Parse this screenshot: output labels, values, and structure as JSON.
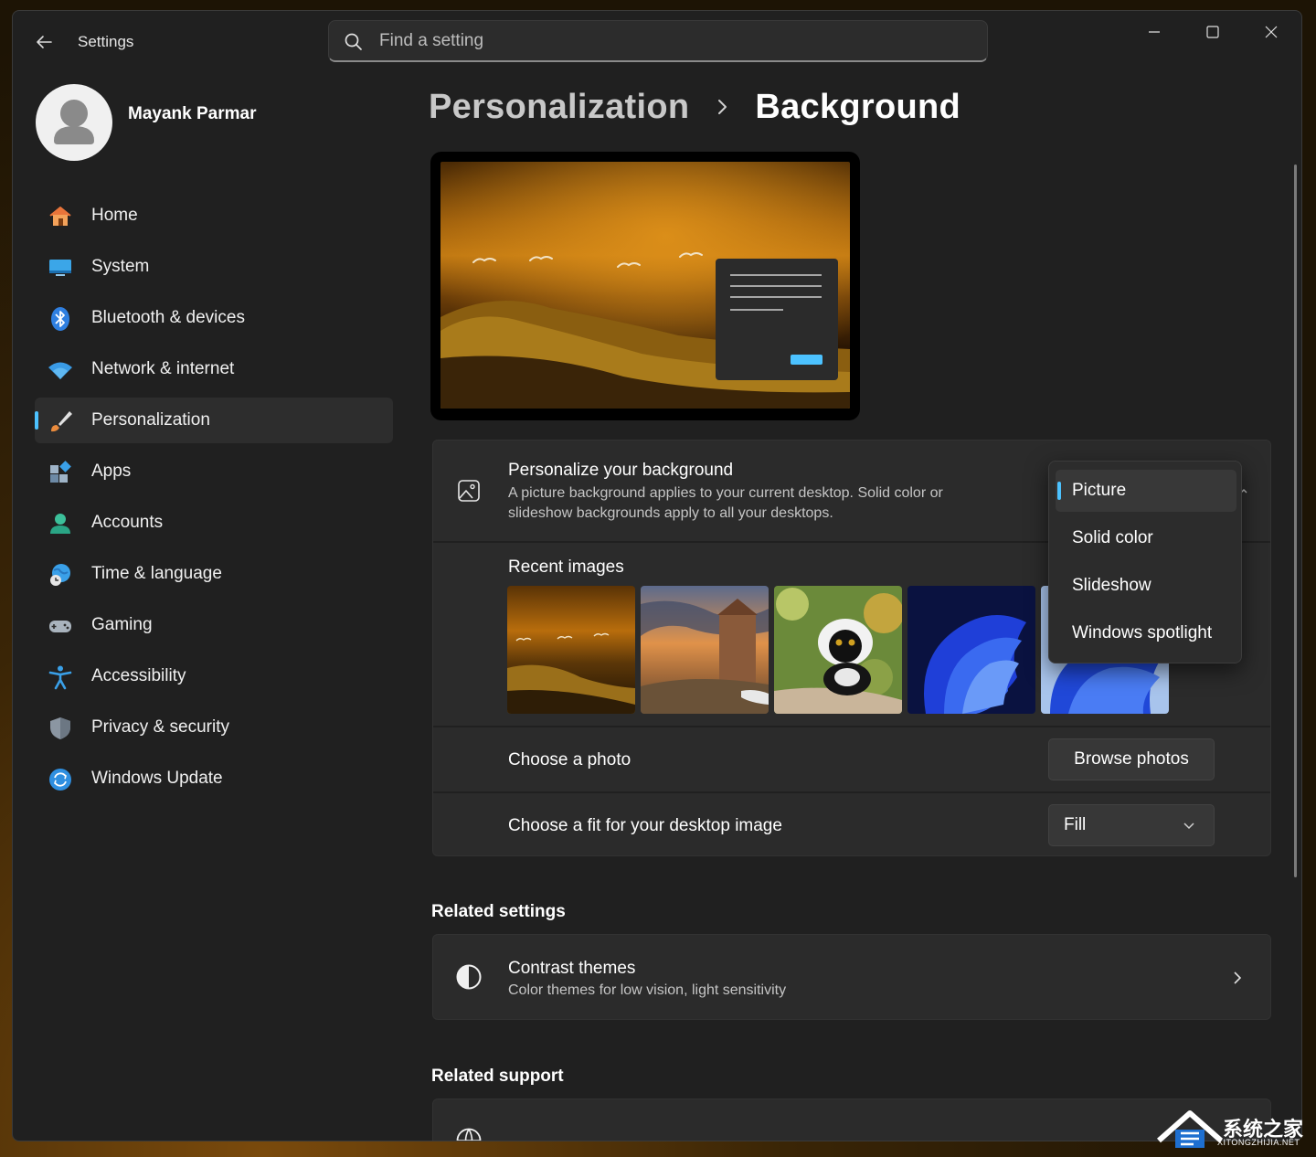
{
  "window": {
    "app_title": "Settings"
  },
  "search": {
    "placeholder": "Find a setting"
  },
  "user": {
    "name": "Mayank Parmar"
  },
  "sidebar": {
    "items": [
      {
        "label": "Home",
        "icon": "home-icon",
        "active": false
      },
      {
        "label": "System",
        "icon": "monitor-icon",
        "active": false
      },
      {
        "label": "Bluetooth & devices",
        "icon": "bluetooth-icon",
        "active": false
      },
      {
        "label": "Network & internet",
        "icon": "wifi-icon",
        "active": false
      },
      {
        "label": "Personalization",
        "icon": "brush-icon",
        "active": true
      },
      {
        "label": "Apps",
        "icon": "apps-icon",
        "active": false
      },
      {
        "label": "Accounts",
        "icon": "person-icon",
        "active": false
      },
      {
        "label": "Time & language",
        "icon": "globe-clock-icon",
        "active": false
      },
      {
        "label": "Gaming",
        "icon": "gamepad-icon",
        "active": false
      },
      {
        "label": "Accessibility",
        "icon": "accessibility-icon",
        "active": false
      },
      {
        "label": "Privacy & security",
        "icon": "shield-icon",
        "active": false
      },
      {
        "label": "Windows Update",
        "icon": "update-icon",
        "active": false
      }
    ]
  },
  "breadcrumb": {
    "parent": "Personalization",
    "current": "Background"
  },
  "personalize": {
    "title": "Personalize your background",
    "description_line1": "A picture background applies to your current desktop. Solid color or",
    "description_line2": "slideshow backgrounds apply to all your desktops.",
    "dropdown_options": [
      "Picture",
      "Solid color",
      "Slideshow",
      "Windows spotlight"
    ],
    "selected": "Picture"
  },
  "recent_images": {
    "title": "Recent images",
    "items": [
      "golden-field-birds",
      "stone-church-sunset",
      "black-white-lemur",
      "windows-bloom-blue",
      "windows-bloom-light"
    ]
  },
  "choose_photo": {
    "label": "Choose a photo",
    "button": "Browse photos"
  },
  "choose_fit": {
    "label": "Choose a fit for your desktop image",
    "value": "Fill"
  },
  "related_settings": {
    "title": "Related settings",
    "contrast": {
      "title": "Contrast themes",
      "subtitle": "Color themes for low vision, light sensitivity"
    }
  },
  "related_support": {
    "title": "Related support"
  },
  "colors": {
    "accent": "#4cc2ff",
    "window_bg": "#202020",
    "card_bg": "#2b2b2b"
  },
  "watermark": {
    "text": "系统之家",
    "sub": "XITONGZHIJIA.NET"
  }
}
